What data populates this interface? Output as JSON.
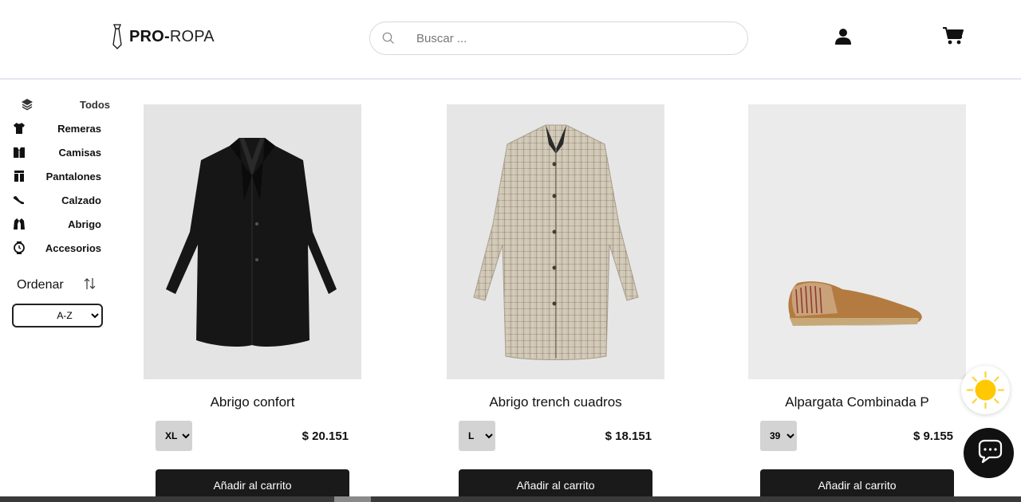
{
  "header": {
    "logo_bold": "PRO-",
    "logo_light": "ROPA",
    "search_placeholder": "Buscar ...",
    "icons": [
      "tie-icon",
      "search-icon",
      "user-icon",
      "cart-icon"
    ]
  },
  "sidebar": {
    "categories": [
      {
        "label": "Todos",
        "icon": "layers-icon"
      },
      {
        "label": "Remeras",
        "icon": "tshirt-icon"
      },
      {
        "label": "Camisas",
        "icon": "shirt-icon"
      },
      {
        "label": "Pantalones",
        "icon": "pants-icon"
      },
      {
        "label": "Calzado",
        "icon": "shoe-icon"
      },
      {
        "label": "Abrigo",
        "icon": "coat-icon"
      },
      {
        "label": "Accesorios",
        "icon": "watch-icon"
      }
    ],
    "sort_label": "Ordenar",
    "sort_value": "A-Z"
  },
  "products": [
    {
      "title": "Abrigo confort",
      "size": "XL",
      "price": "$ 20.151",
      "button": "Añadir al carrito",
      "image": "black-coat"
    },
    {
      "title": "Abrigo trench cuadros",
      "size": "L",
      "price": "$ 18.151",
      "button": "Añadir al carrito",
      "image": "plaid-trench-coat"
    },
    {
      "title": "Alpargata Combinada P",
      "size": "39",
      "price": "$ 9.155",
      "button": "Añadir al carrito",
      "image": "espadrille-shoe"
    }
  ],
  "floating": {
    "theme_icon": "sun-icon",
    "chat_icon": "chat-icon"
  },
  "colors": {
    "accent_dark": "#1a1a1a",
    "image_bg": "#e3e3e3",
    "sun": "#ffc800"
  }
}
